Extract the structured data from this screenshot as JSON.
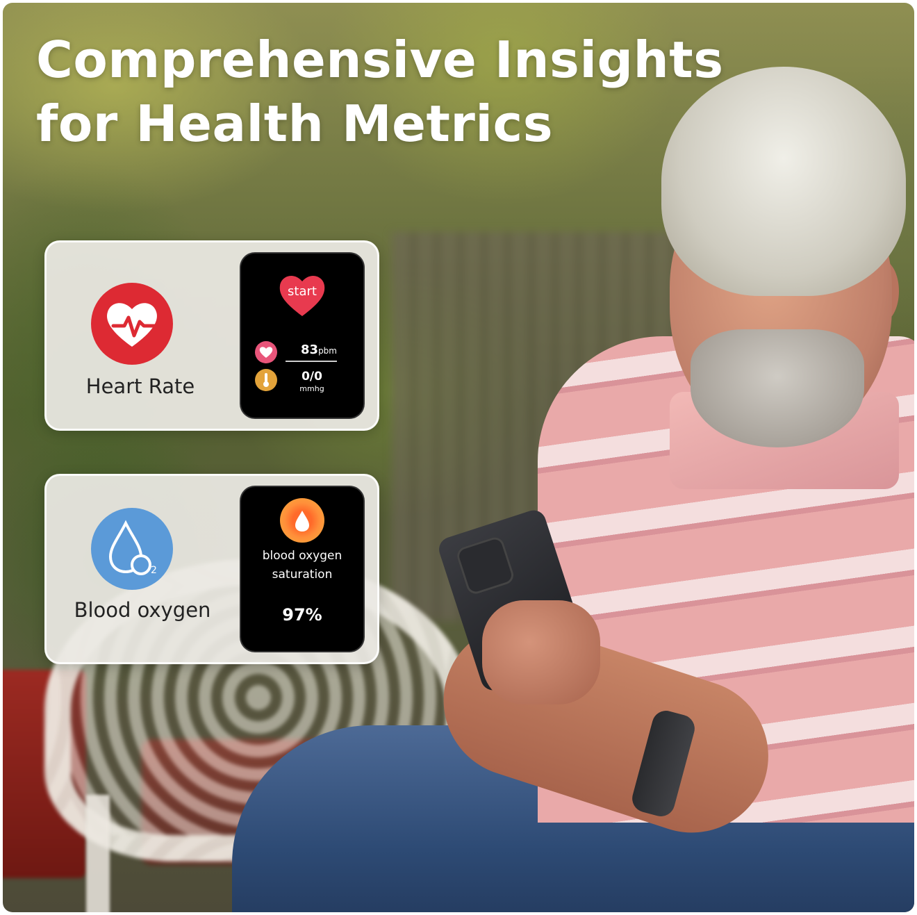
{
  "headline": {
    "line1": "Comprehensive Insights",
    "line2": "for Health Metrics"
  },
  "cards": {
    "heart_rate": {
      "label": "Heart Rate",
      "icon": "heart-pulse-icon",
      "icon_color": "#dd2a33",
      "watch": {
        "start_label": "start",
        "bpm_value": "83",
        "bpm_unit": "pbm",
        "pressure_value": "0/0",
        "pressure_unit": "mmhg"
      }
    },
    "blood_oxygen": {
      "label": "Blood oxygen",
      "icon": "o2-droplet-icon",
      "icon_color": "#5b9ad8",
      "watch": {
        "title": "blood oxygen saturation",
        "value": "97%"
      }
    }
  }
}
